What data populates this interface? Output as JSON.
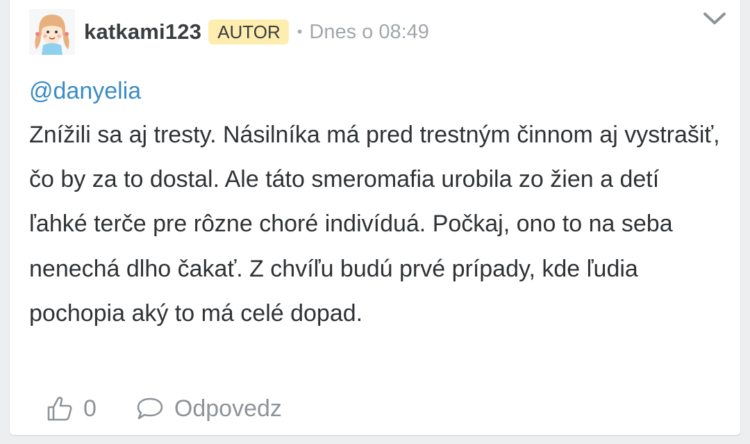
{
  "comment": {
    "author": {
      "username": "katkami123",
      "badge": "AUTOR",
      "avatar_icon": "cartoon-girl-avatar"
    },
    "separator": "•",
    "timestamp": "Dnes o 08:49",
    "mention": "@danyelia",
    "text": "Znížili sa aj tresty. Násilníka má pred trestným činnom aj vystrašiť, čo by za to dostal. Ale táto smeromafia urobila zo žien a detí ľahké terče pre rôzne choré indivíduá. Počkaj, ono to na seba nenechá dlho čakať. Z chvíľu budú prvé prípady, kde ľudia pochopia aký to má celé dopad.",
    "actions": {
      "like_icon": "thumbs-up-icon",
      "like_count": "0",
      "reply_icon": "speech-bubble-icon",
      "reply_label": "Odpovedz"
    },
    "menu_icon": "chevron-down-icon"
  },
  "colors": {
    "mention": "#3a8cc4",
    "badge_bg": "#fdeeb0",
    "muted": "#a2a7ac",
    "text": "#2f3235",
    "background": "#eceeef"
  }
}
